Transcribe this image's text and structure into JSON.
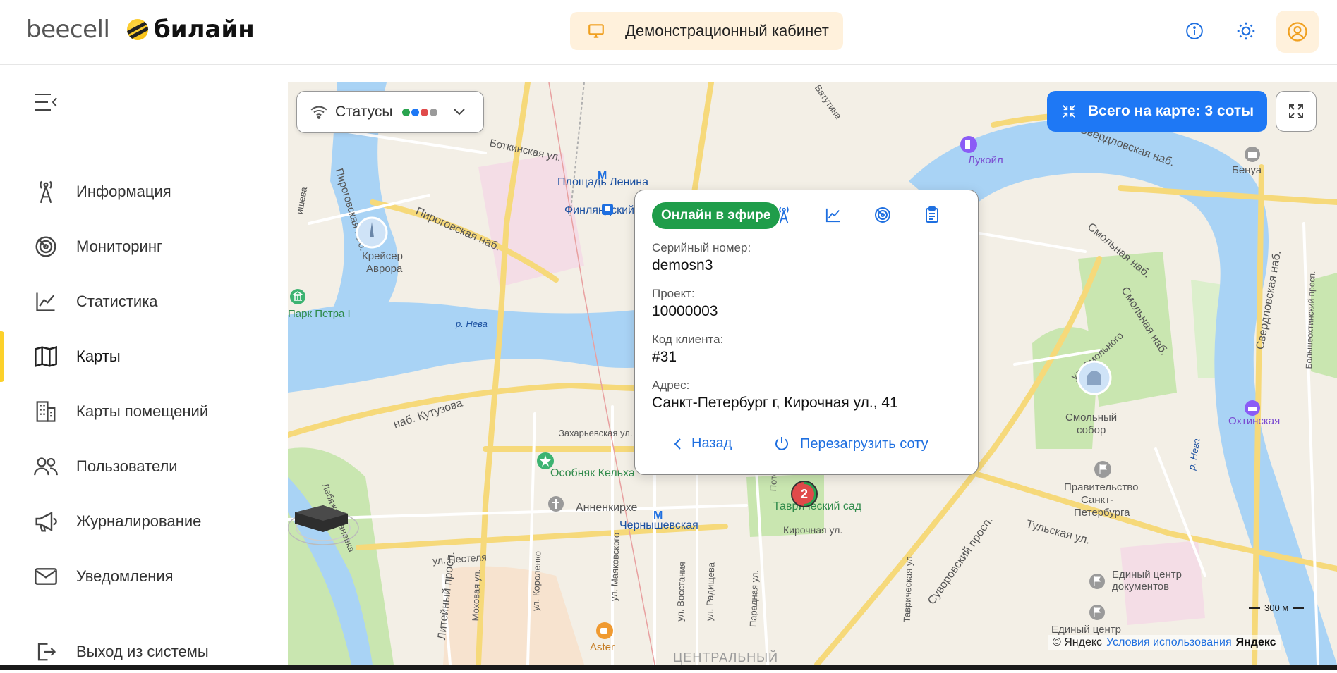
{
  "header": {
    "logo_beecell": "beecell",
    "logo_beeline": "билайн",
    "demo_label": "Демонстрационный кабинет",
    "info_icon": "info-icon",
    "theme_icon": "sun-icon",
    "user_icon": "user-icon"
  },
  "sidebar": {
    "collapse_icon": "collapse-menu-icon",
    "items": [
      {
        "label": "Информация",
        "icon": "tower-icon",
        "active": false
      },
      {
        "label": "Мониторинг",
        "icon": "radar-icon",
        "active": false
      },
      {
        "label": "Статистика",
        "icon": "chart-line-icon",
        "active": false
      },
      {
        "label": "Карты",
        "icon": "map-icon",
        "active": true
      },
      {
        "label": "Карты помещений",
        "icon": "building-icon",
        "active": false
      },
      {
        "label": "Пользователи",
        "icon": "users-icon",
        "active": false
      },
      {
        "label": "Журналирование",
        "icon": "megaphone-icon",
        "active": false
      },
      {
        "label": "Уведомления",
        "icon": "envelope-icon",
        "active": false
      }
    ],
    "logout": "Выход из системы"
  },
  "map": {
    "statuses_label": "Статусы",
    "status_colors": [
      "#2aa44f",
      "#1e78f5",
      "#e04a4a",
      "#9a9a9a"
    ],
    "total_label": "Всего на карте: 3 соты",
    "cluster_count": "2",
    "scale_label": "300 м",
    "copyright": "© Яндекс",
    "terms": "Условия использования",
    "yandex": "Яндекс",
    "labels": {
      "botkinskaya": "Боткинская ул.",
      "pirogovskaya": "Пироговская наб.",
      "pirogovskaya2": "Пироговская наб.",
      "ploshchad_lenina": "Площадь Ленина",
      "finlyandsky": "Финляндский",
      "kreiser": "Крейсер",
      "avrora": "Аврора",
      "park_petra": "Парк Петра I",
      "neva1": "р. Нева",
      "kutuzova": "наб. Кутузова",
      "zakharyevskaya": "Захарьевская ул.",
      "osobnyak": "Особняк Кельха",
      "annenkirhe": "Анненкирхе",
      "chernyshevskaya": "Чернышевская",
      "tavrichesky": "Таврический сад",
      "kirochnaya": "Кирочная ул.",
      "pestelya": "ул. Пестеля",
      "liteyny": "Литейный просп.",
      "aster": "Aster",
      "centralny": "ЦЕНТРАЛЬНЫЙ",
      "lukoil": "Лукойл",
      "sverdlovskaya": "Свердловская наб.",
      "benua": "Бенуа",
      "smolnaya": "Смольная наб.",
      "smolnaya2": "Смольная наб.",
      "smolny_sobor": "Смольный",
      "smolny_sobor2": "собор",
      "okhtinskaya": "Охтинская",
      "pravitelstvo": "Правительство",
      "pravitelstvo2": "Санкт-",
      "pravitelstvo3": "Петербурга",
      "tulskaya": "Тульская ул.",
      "suvorovsky": "Суворовский просп.",
      "tavricheskaya": "Таврическая ул.",
      "edinyi": "Единый центр",
      "edinyi2": "документов",
      "edinyi3": "Единый центр",
      "neva2": "р. Нева",
      "lebyazhya": "Лебяжья канавка",
      "potemkinskaya": "Потёмкинская",
      "paradnaya": "Парадная ул.",
      "vosstaniya": "ул. Восстания",
      "radishcheva": "ул. Радищева",
      "mayakovskogo": "ул. Маяковского",
      "korolenko": "ул. Короленко",
      "mokhovaya": "Моховая ул.",
      "vatutina": "Ватутина",
      "smolnogo": "ул. Смольного",
      "bolsheokhtinsky": "Большеохтинский просп.",
      "sverdl_vert": "Свердловская наб.",
      "vishneva": "ишева"
    }
  },
  "popup": {
    "status_badge": "Онлайн в эфире",
    "serial_label": "Серийный номер:",
    "serial_value": "demosn3",
    "project_label": "Проект:",
    "project_value": "10000003",
    "client_label": "Код клиента:",
    "client_value": "#31",
    "address_label": "Адрес:",
    "address_value": "Санкт-Петербург г, Кирочная ул., 41",
    "back_label": "Назад",
    "reboot_label": "Перезагрузить соту",
    "icons": [
      "tower-icon",
      "chart-line-icon",
      "radar-icon",
      "clipboard-icon"
    ]
  }
}
